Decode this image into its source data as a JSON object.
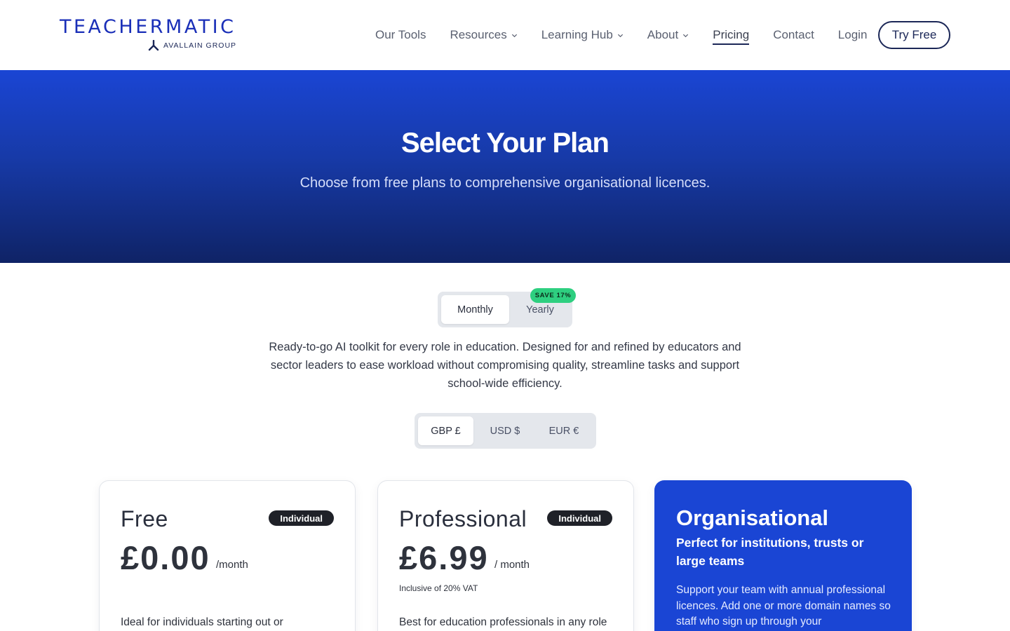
{
  "brand": {
    "name": "TEACHERMATIC",
    "group": "AVALLAIN GROUP"
  },
  "nav": {
    "items": [
      {
        "label": "Our Tools",
        "dropdown": false
      },
      {
        "label": "Resources",
        "dropdown": true
      },
      {
        "label": "Learning Hub",
        "dropdown": true
      },
      {
        "label": "About",
        "dropdown": true
      },
      {
        "label": "Pricing",
        "dropdown": false,
        "active": true
      },
      {
        "label": "Contact",
        "dropdown": false
      },
      {
        "label": "Login",
        "dropdown": false
      }
    ],
    "cta": "Try Free"
  },
  "hero": {
    "title": "Select Your Plan",
    "subtitle": "Choose from free plans to comprehensive organisational licences."
  },
  "billing": {
    "options": [
      "Monthly",
      "Yearly"
    ],
    "selected": "Monthly",
    "save_badge": "SAVE 17%"
  },
  "intro": "Ready-to-go AI toolkit for every role in education. Designed for and refined by educators and sector leaders to ease workload without compromising quality, streamline tasks and support school-wide efficiency.",
  "currency": {
    "options": [
      "GBP £",
      "USD $",
      "EUR €"
    ],
    "selected": "GBP £"
  },
  "plans": [
    {
      "name": "Free",
      "badge": "Individual",
      "price": "£0.00",
      "period": "/month",
      "vat": "",
      "description": "Ideal for individuals starting out or"
    },
    {
      "name": "Professional",
      "badge": "Individual",
      "price": "£6.99",
      "period": "/ month",
      "vat": "Inclusive of 20% VAT",
      "description": "Best for education professionals in any role"
    },
    {
      "name": "Organisational",
      "tagline": "Perfect for institutions, trusts or large teams",
      "description": "Support your team with annual professional licences. Add one or more domain names so staff who sign up through your"
    }
  ],
  "colors": {
    "brand_blue": "#1a45d4",
    "navy": "#1b2757",
    "save_green": "#2ecf80",
    "badge_dark": "#1f2128"
  },
  "icons": {
    "chevron": "chevron-down-icon",
    "logo_mark": "avallain-mark-icon"
  }
}
